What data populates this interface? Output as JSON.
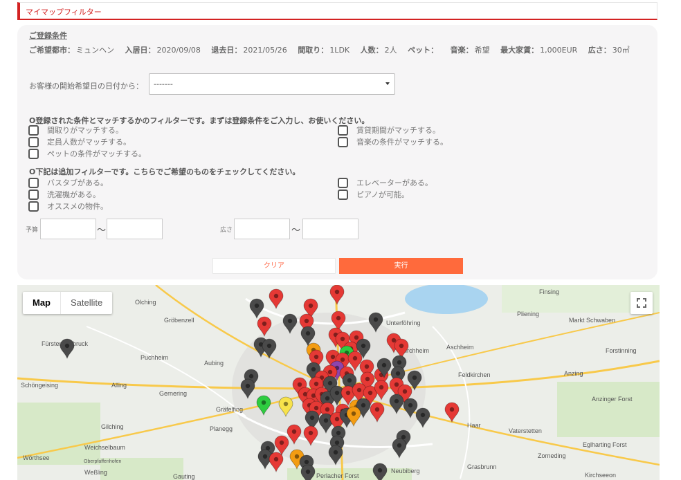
{
  "header": {
    "title": "マイマップフィルター"
  },
  "conditions": {
    "heading": "ご登録条件",
    "items": [
      {
        "label": "ご希望都市：",
        "value": "ミュンヘン"
      },
      {
        "label": "入居日：",
        "value": "2020/09/08"
      },
      {
        "label": "退去日：",
        "value": "2021/05/26"
      },
      {
        "label": "間取り：",
        "value": "1LDK"
      },
      {
        "label": "人数：",
        "value": "2人"
      },
      {
        "label": "ペット：",
        "value": ""
      },
      {
        "label": "音楽：",
        "value": "希望"
      },
      {
        "label": "最大家賃：",
        "value": "1,000EUR"
      },
      {
        "label": "広さ：",
        "value": "30㎡"
      }
    ]
  },
  "start_date": {
    "label": "お客様の開始希望日の日付から：",
    "selected": "-------"
  },
  "match_filters": {
    "heading": "O登録された条件とマッチするかのフィルターです。まずは登録条件をご入力し、お使いください。",
    "left": [
      "間取りがマッチする。",
      "定員人数がマッチする。",
      "ペットの条件がマッチする。"
    ],
    "right": [
      "賃貸期間がマッチする。",
      "音楽の条件がマッチする。"
    ]
  },
  "extra_filters": {
    "heading": "O下記は追加フィルターです。こちらでご希望のものをチェックしてください。",
    "left": [
      "バスタブがある。",
      "洗濯機がある。",
      "オススメの物件。"
    ],
    "right": [
      "エレベーターがある。",
      "ピアノが可能。"
    ]
  },
  "ranges": {
    "budget_label": "予算",
    "area_label": "広さ",
    "tilde": "〜"
  },
  "buttons": {
    "clear": "クリア",
    "run": "実行"
  },
  "map": {
    "type_map": "Map",
    "type_satellite": "Satellite",
    "places": [
      "Olching",
      "Gröbenzell",
      "Fürstenfeldbruck",
      "Puchheim",
      "Aubing",
      "Schöngeising",
      "Alling",
      "Gernering",
      "Gräfelfing",
      "Planegg",
      "Gilching",
      "Weichselbaum",
      "Wörthsee",
      "Weßling",
      "Gauting",
      "Finsing",
      "Pliening",
      "Markt Schwaben",
      "Unterföhring",
      "Aschheim",
      "Kirchheim",
      "Forstinning",
      "Feldkirchen",
      "Anzing",
      "Anzinger Forst",
      "Haar",
      "Vaterstetten",
      "Zorneding",
      "Eglharting Forst",
      "Grasbrunn",
      "Neubiberg",
      "Perlacher Forst",
      "Kirchseeon",
      "Oberpfaffenhofen"
    ],
    "colors": {
      "red": "#e53935",
      "gray": "#4a4a4a",
      "orange": "#f39c12",
      "green": "#2ecc40",
      "yellow": "#f7e24b",
      "purple": "#8e44ad"
    }
  }
}
